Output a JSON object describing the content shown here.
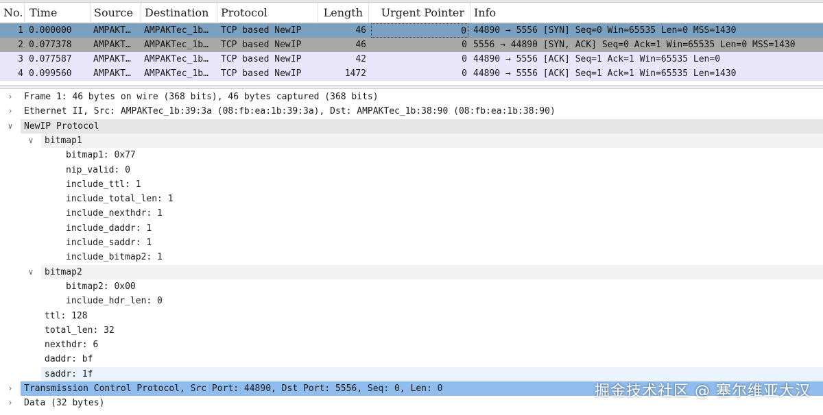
{
  "columns": [
    {
      "key": "no",
      "label": "No.",
      "align": "left"
    },
    {
      "key": "time",
      "label": "Time",
      "align": "left"
    },
    {
      "key": "source",
      "label": "Source",
      "align": "left"
    },
    {
      "key": "destination",
      "label": "Destination",
      "align": "left"
    },
    {
      "key": "protocol",
      "label": "Protocol",
      "align": "left"
    },
    {
      "key": "length",
      "label": "Length",
      "align": "right"
    },
    {
      "key": "urgent",
      "label": "Urgent Pointer",
      "align": "right"
    },
    {
      "key": "info",
      "label": "Info",
      "align": "left"
    }
  ],
  "packets": [
    {
      "no": "1",
      "time": "0.000000",
      "source": "AMPAKT…",
      "destination": "AMPAKTec_1b…",
      "protocol": "TCP based NewIP",
      "length": "46",
      "urgent": "0",
      "info": "44890 → 5556 [SYN] Seq=0 Win=65535 Len=0 MSS=1430"
    },
    {
      "no": "2",
      "time": "0.077378",
      "source": "AMPAKT…",
      "destination": "AMPAKTec_1b…",
      "protocol": "TCP based NewIP",
      "length": "46",
      "urgent": "0",
      "info": "5556 → 44890 [SYN, ACK] Seq=0 Ack=1 Win=65535 Len=0 MSS=1430"
    },
    {
      "no": "3",
      "time": "0.077587",
      "source": "AMPAKT…",
      "destination": "AMPAKTec_1b…",
      "protocol": "TCP based NewIP",
      "length": "42",
      "urgent": "0",
      "info": "44890 → 5556 [ACK] Seq=1 Ack=1 Win=65535 Len=0"
    },
    {
      "no": "4",
      "time": "0.099560",
      "source": "AMPAKT…",
      "destination": "AMPAKTec_1b…",
      "protocol": "TCP based NewIP",
      "length": "1472",
      "urgent": "0",
      "info": "44890 → 5556 [ACK] Seq=1 Ack=1 Win=65535 Len=1430"
    }
  ],
  "details": [
    {
      "text": "Frame 1: 46 bytes on wire (368 bits), 46 bytes captured (368 bits)",
      "level": 0,
      "arrow": "collapsed"
    },
    {
      "text": "Ethernet II, Src: AMPAKTec_1b:39:3a (08:fb:ea:1b:39:3a), Dst: AMPAKTec_1b:38:90 (08:fb:ea:1b:38:90)",
      "level": 0,
      "arrow": "collapsed"
    },
    {
      "text": "NewIP Protocol",
      "level": 0,
      "arrow": "expanded"
    },
    {
      "text": "bitmap1",
      "level": 1,
      "arrow": "expanded"
    },
    {
      "text": "bitmap1: 0x77",
      "level": 2,
      "arrow": "none"
    },
    {
      "text": "nip_valid: 0",
      "level": 2,
      "arrow": "none"
    },
    {
      "text": "include_ttl: 1",
      "level": 2,
      "arrow": "none"
    },
    {
      "text": "include_total_len: 1",
      "level": 2,
      "arrow": "none"
    },
    {
      "text": "include_nexthdr: 1",
      "level": 2,
      "arrow": "none"
    },
    {
      "text": "include_daddr: 1",
      "level": 2,
      "arrow": "none"
    },
    {
      "text": "include_saddr: 1",
      "level": 2,
      "arrow": "none"
    },
    {
      "text": "include_bitmap2: 1",
      "level": 2,
      "arrow": "none"
    },
    {
      "text": "bitmap2",
      "level": 1,
      "arrow": "expanded"
    },
    {
      "text": "bitmap2: 0x00",
      "level": 2,
      "arrow": "none"
    },
    {
      "text": "include_hdr_len: 0",
      "level": 2,
      "arrow": "none"
    },
    {
      "text": "ttl: 128",
      "level": 1,
      "arrow": "none"
    },
    {
      "text": "total_len: 32",
      "level": 1,
      "arrow": "none"
    },
    {
      "text": "nexthdr: 6",
      "level": 1,
      "arrow": "none"
    },
    {
      "text": "daddr: bf",
      "level": 1,
      "arrow": "none"
    },
    {
      "text": "saddr: 1f",
      "level": 1,
      "arrow": "none"
    },
    {
      "text": "Transmission Control Protocol, Src Port: 44890, Dst Port: 5556, Seq: 0, Len: 0",
      "level": 0,
      "arrow": "collapsed"
    },
    {
      "text": "Data (32 bytes)",
      "level": 0,
      "arrow": "collapsed"
    }
  ],
  "selected_detail": "Transmission Control Protocol",
  "watermark": "掘金技术社区 @ 塞尔维亚大汉",
  "colors": {
    "row_selected": "#7a9fbf",
    "row_related": "#a8a8a8",
    "row_tcp": "#e9e6fb",
    "detail_selected": "#8fbcec",
    "detail_header": "#e6e6e6"
  }
}
